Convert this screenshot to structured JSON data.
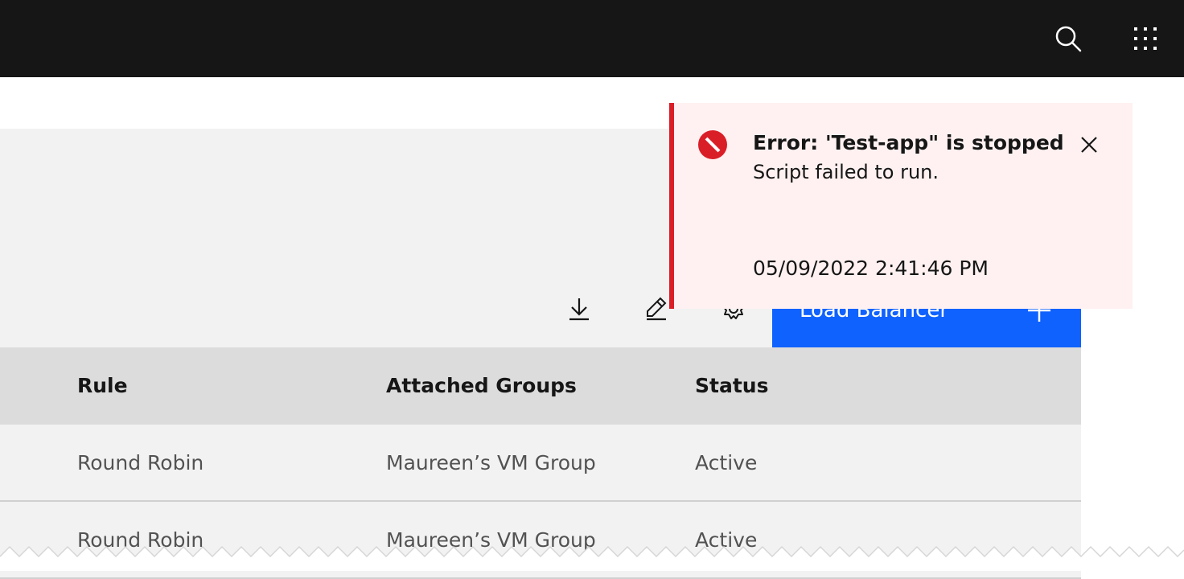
{
  "header": {
    "search_icon": "search-icon",
    "switcher_icon": "app-switcher-icon",
    "background": "#161616"
  },
  "toolbar": {
    "download_icon": "download-icon",
    "edit_icon": "edit-icon",
    "settings_icon": "settings-icon",
    "primary_button_label": "Load Balancer",
    "primary_button_icon": "add-icon",
    "primary_color": "#0f62fe"
  },
  "table": {
    "columns": [
      "Rule",
      "Attached Groups",
      "Status"
    ],
    "rows": [
      [
        "Round Robin",
        "Maureen’s VM Group",
        "Active"
      ],
      [
        "Round Robin",
        "Maureen’s VM Group",
        "Active"
      ]
    ]
  },
  "notification": {
    "kind": "error",
    "title": "Error: 'Test-app\" is stopped",
    "subtitle": "Script failed to run.",
    "caption": "05/09/2022 2:41:46 PM",
    "accent_color": "#da1e28",
    "background": "#fff1f1"
  }
}
